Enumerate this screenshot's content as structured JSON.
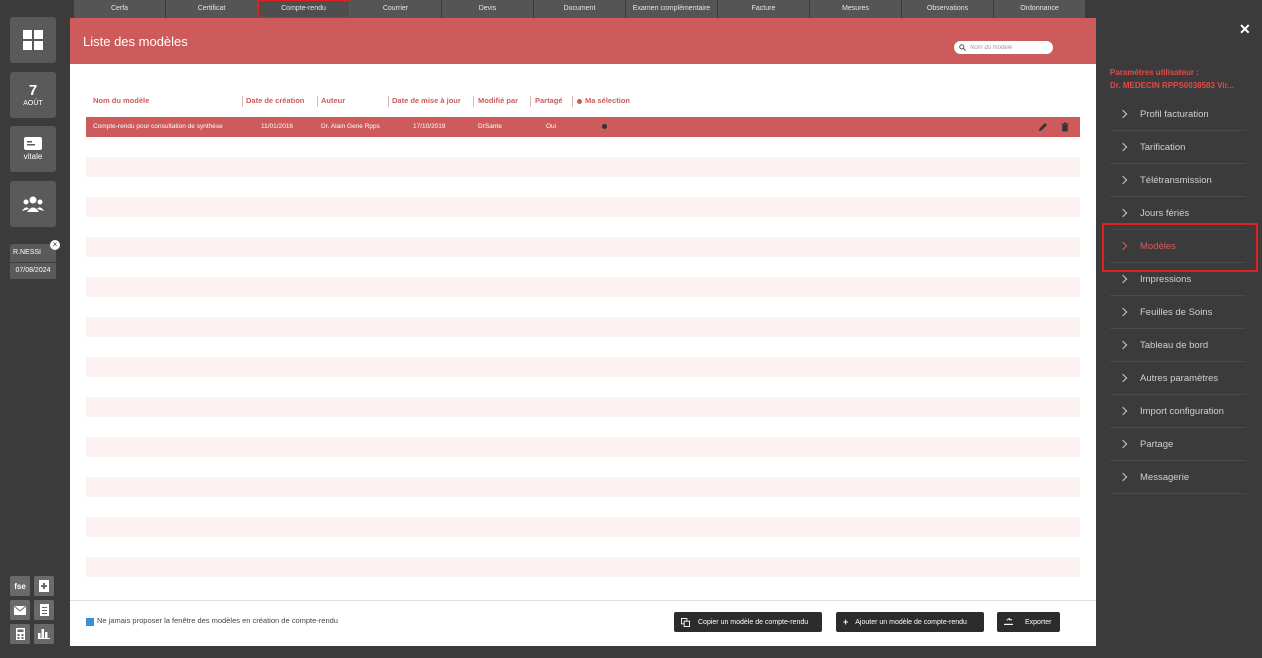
{
  "left_bar": {
    "dashboard_icon": "grid-icon",
    "calendar": {
      "day": "7",
      "month": "AOÛT"
    },
    "vitale_label": "vitale",
    "team_icon": "group-icon",
    "patient": {
      "name": "R.NESSI",
      "date": "07/08/2024"
    },
    "bottom": {
      "fse": "fse"
    }
  },
  "tabs": [
    "Cerfa",
    "Certificat",
    "Compte-rendu",
    "Courrier",
    "Devis",
    "Document",
    "Examen complémentaire",
    "Facture",
    "Mesures",
    "Observations",
    "Ordonnance"
  ],
  "modal": {
    "title": "Liste des modèles",
    "search_placeholder": "Nom du modèle",
    "columns": {
      "name": "Nom du modèle",
      "created": "Date de création",
      "author": "Auteur",
      "updated": "Date de mise à jour",
      "modified_by": "Modifié par",
      "shared": "Partagé",
      "selection": "Ma sélection"
    },
    "rows": [
      {
        "name": "Compte-rendu pour consultation de synthèse",
        "created": "11/01/2016",
        "author": "Dr. Alain Gene Rpps",
        "updated": "17/10/2019",
        "modified_by": "DrSante",
        "shared": "Oui"
      }
    ],
    "footer": {
      "checkbox_label": "Ne jamais proposer la fenêtre des modèles en création de compte-rendu",
      "copy_button": "Copier un modèle de compte-rendu",
      "add_button": "Ajouter un modèle de compte-rendu",
      "export_button": "Exporter"
    }
  },
  "right_panel": {
    "title_line1": "Paramètres utilisateur :",
    "title_line2": "Dr. MEDECIN RPPS0038583 Vir...",
    "items": [
      "Profil facturation",
      "Tarification",
      "Télétransmission",
      "Jours fériés",
      "Modèles",
      "Impressions",
      "Feuilles de Soins",
      "Tableau de bord",
      "Autres paramètres",
      "Import configuration",
      "Partage",
      "Messagerie"
    ],
    "active_index": 4
  },
  "colors": {
    "accent": "#cd5b5b",
    "highlight": "#e02020",
    "dark": "#3b3b3b"
  }
}
